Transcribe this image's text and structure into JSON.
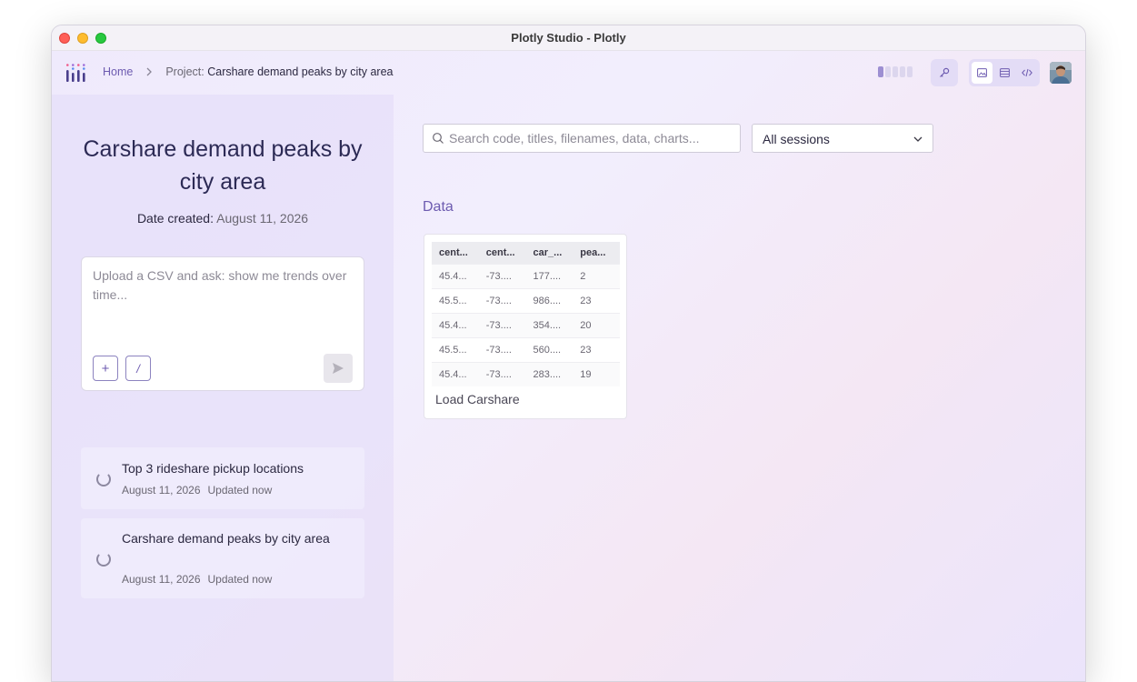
{
  "window": {
    "title": "Plotly Studio - Plotly"
  },
  "breadcrumb": {
    "home": "Home",
    "separator": ">",
    "project_label": "Project:",
    "project_name": "Carshare demand peaks by city area"
  },
  "icons": {
    "logo": "plotly-logo-icon",
    "key": "key-icon",
    "views": [
      "image-view-icon",
      "list-view-icon",
      "code-view-icon"
    ],
    "search": "search-icon",
    "chevron": "chevron-down-icon",
    "send": "send-icon"
  },
  "sidebar": {
    "project_title": "Carshare demand peaks by city area",
    "date_label": "Date created:",
    "date_value": "August 11, 2026",
    "prompt_placeholder": "Upload a CSV and ask: show me trends over time...",
    "add_label": "+",
    "slash_label": "/",
    "sessions": [
      {
        "title": "Top 3 rideshare pickup locations",
        "date": "August 11, 2026",
        "updated": "Updated now"
      },
      {
        "title": "Carshare demand peaks by city area",
        "date": "August 11, 2026",
        "updated": "Updated now"
      }
    ]
  },
  "main": {
    "search_placeholder": "Search code, titles, filenames, data, charts...",
    "session_filter": "All sessions",
    "data_heading": "Data",
    "data_card": {
      "columns": [
        "cent...",
        "cent...",
        "car_...",
        "pea..."
      ],
      "rows": [
        [
          "45.4...",
          "-73....",
          "177....",
          "2"
        ],
        [
          "45.5...",
          "-73....",
          "986....",
          "23"
        ],
        [
          "45.4...",
          "-73....",
          "354....",
          "20"
        ],
        [
          "45.5...",
          "-73....",
          "560....",
          "23"
        ],
        [
          "45.4...",
          "-73....",
          "283....",
          "19"
        ]
      ],
      "caption": "Load Carshare"
    }
  },
  "colors": {
    "accent": "#6d5bb0",
    "title": "#2c2a55"
  }
}
